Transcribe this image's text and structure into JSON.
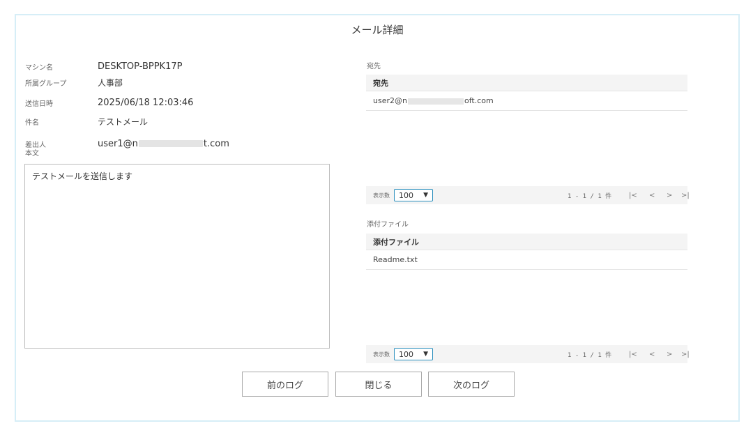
{
  "dialog": {
    "title": "メール詳細"
  },
  "info": {
    "machine_label": "マシン名",
    "machine_value": "DESKTOP-BPPK17P",
    "group_label": "所属グループ",
    "group_value": "人事部",
    "sent_label": "送信日時",
    "sent_value": "2025/06/18 12:03:46",
    "subject_label": "件名",
    "subject_value": "テストメール",
    "sender_label": "差出人",
    "sender_value_prefix": "user1@n",
    "sender_value_suffix": "t.com"
  },
  "body": {
    "label": "本文",
    "text": "テストメールを送信します"
  },
  "recipients": {
    "section_label": "宛先",
    "header": "宛先",
    "rows": [
      {
        "prefix": "user2@n",
        "suffix": "oft.com"
      }
    ],
    "footer": {
      "count_label": "表示数",
      "page_size": "100",
      "page_info": "1 - 1 / 1 件",
      "first": "|<",
      "prev": "<",
      "next": ">",
      "last": ">|"
    }
  },
  "attachments": {
    "section_label": "添付ファイル",
    "header": "添付ファイル",
    "rows": [
      "Readme.txt"
    ],
    "footer": {
      "count_label": "表示数",
      "page_size": "100",
      "page_info": "1 - 1 / 1 件",
      "first": "|<",
      "prev": "<",
      "next": ">",
      "last": ">|"
    }
  },
  "buttons": {
    "prev_log": "前のログ",
    "close": "閉じる",
    "next_log": "次のログ"
  }
}
